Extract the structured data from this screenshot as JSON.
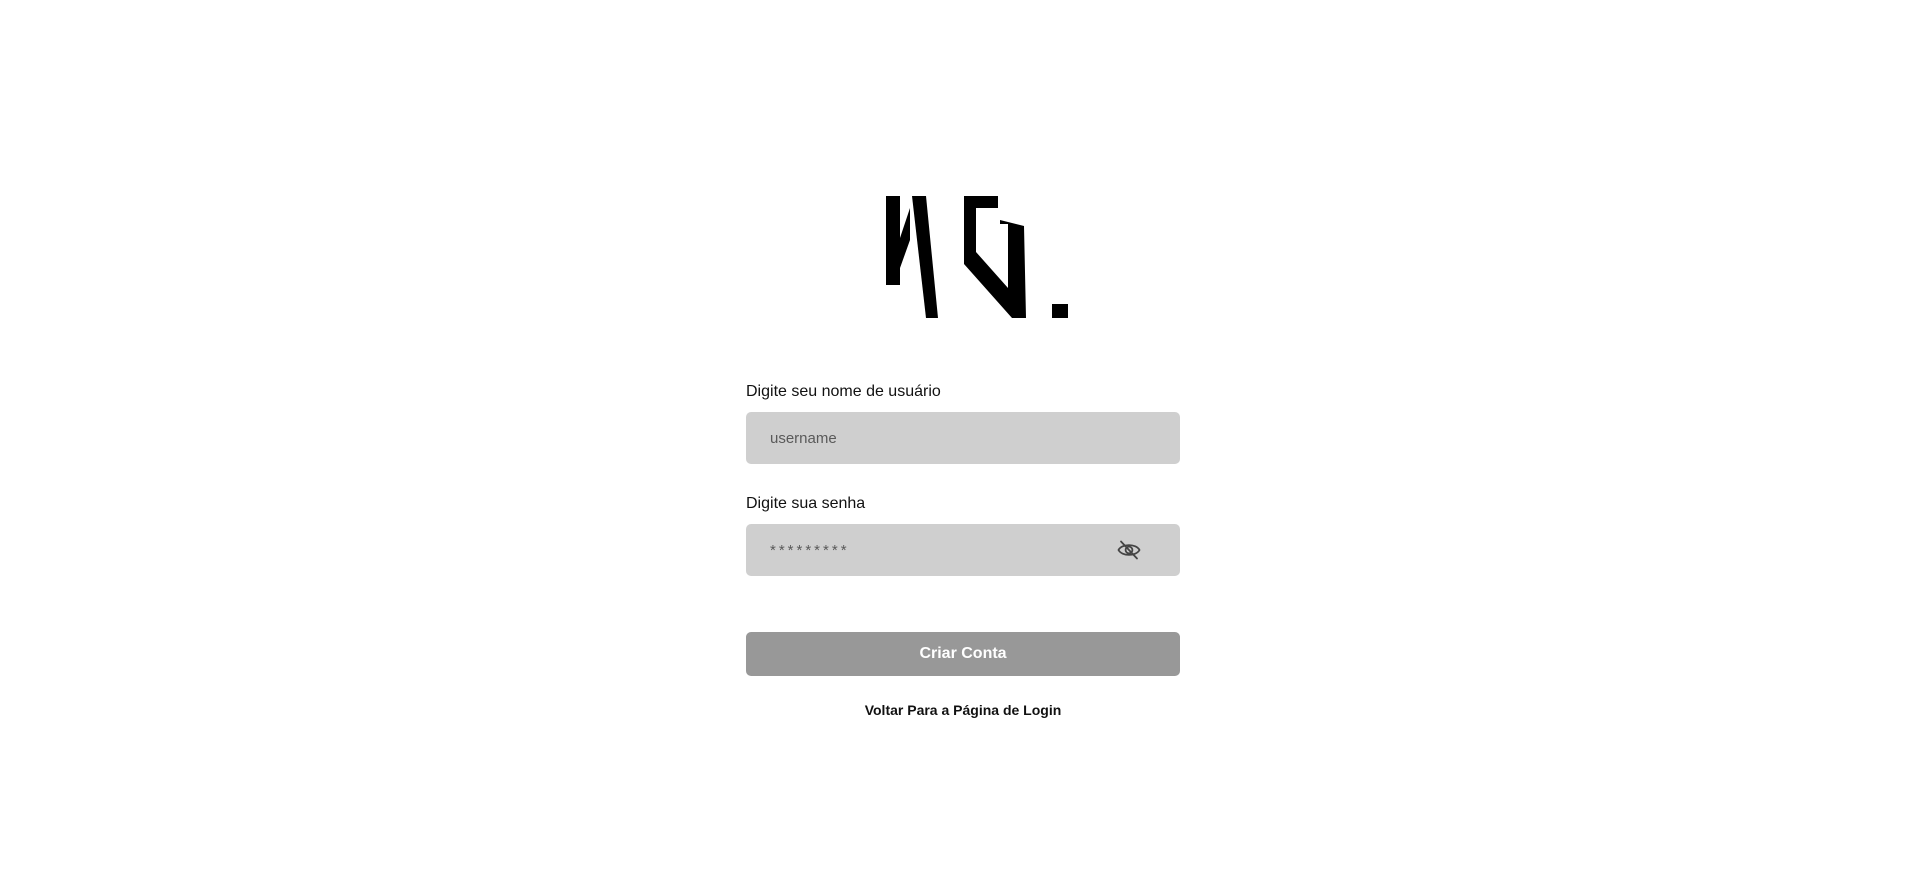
{
  "logo": {
    "icon": "ng-logo-mark",
    "text": "NG."
  },
  "form": {
    "username": {
      "label": "Digite seu nome de usuário",
      "placeholder": "username",
      "value": ""
    },
    "password": {
      "label": "Digite sua senha",
      "placeholder": "*********",
      "value": "",
      "toggle_icon": "eye-slash-icon"
    },
    "submit_label": "Criar Conta",
    "back_link_label": "Voltar Para a Página de Login"
  },
  "colors": {
    "background": "#ffffff",
    "input_background": "#cfcfcf",
    "button_background": "#989898",
    "button_text": "#ffffff",
    "text": "#111111"
  }
}
